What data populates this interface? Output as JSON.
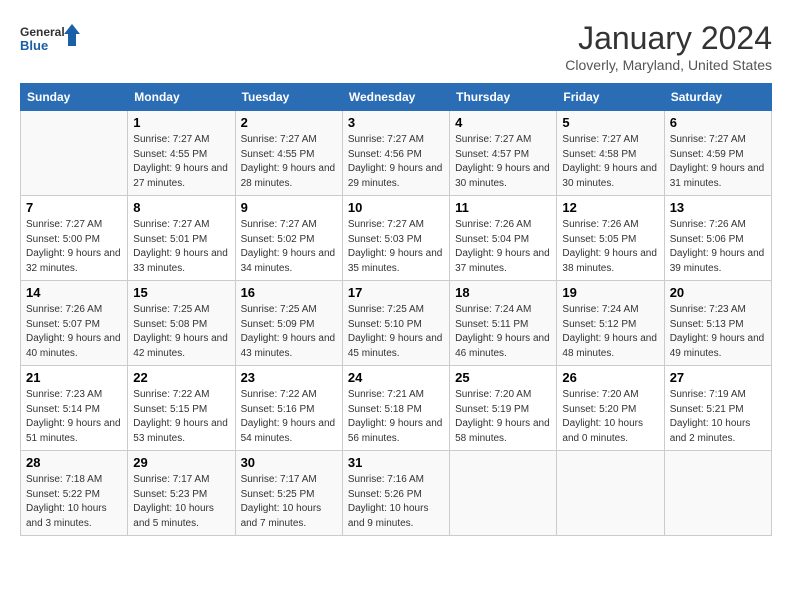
{
  "header": {
    "logo_general": "General",
    "logo_blue": "Blue",
    "month": "January 2024",
    "location": "Cloverly, Maryland, United States"
  },
  "days_of_week": [
    "Sunday",
    "Monday",
    "Tuesday",
    "Wednesday",
    "Thursday",
    "Friday",
    "Saturday"
  ],
  "weeks": [
    [
      {
        "num": "",
        "text": ""
      },
      {
        "num": "1",
        "text": "Sunrise: 7:27 AM\nSunset: 4:55 PM\nDaylight: 9 hours\nand 27 minutes."
      },
      {
        "num": "2",
        "text": "Sunrise: 7:27 AM\nSunset: 4:55 PM\nDaylight: 9 hours\nand 28 minutes."
      },
      {
        "num": "3",
        "text": "Sunrise: 7:27 AM\nSunset: 4:56 PM\nDaylight: 9 hours\nand 29 minutes."
      },
      {
        "num": "4",
        "text": "Sunrise: 7:27 AM\nSunset: 4:57 PM\nDaylight: 9 hours\nand 30 minutes."
      },
      {
        "num": "5",
        "text": "Sunrise: 7:27 AM\nSunset: 4:58 PM\nDaylight: 9 hours\nand 30 minutes."
      },
      {
        "num": "6",
        "text": "Sunrise: 7:27 AM\nSunset: 4:59 PM\nDaylight: 9 hours\nand 31 minutes."
      }
    ],
    [
      {
        "num": "7",
        "text": "Sunrise: 7:27 AM\nSunset: 5:00 PM\nDaylight: 9 hours\nand 32 minutes."
      },
      {
        "num": "8",
        "text": "Sunrise: 7:27 AM\nSunset: 5:01 PM\nDaylight: 9 hours\nand 33 minutes."
      },
      {
        "num": "9",
        "text": "Sunrise: 7:27 AM\nSunset: 5:02 PM\nDaylight: 9 hours\nand 34 minutes."
      },
      {
        "num": "10",
        "text": "Sunrise: 7:27 AM\nSunset: 5:03 PM\nDaylight: 9 hours\nand 35 minutes."
      },
      {
        "num": "11",
        "text": "Sunrise: 7:26 AM\nSunset: 5:04 PM\nDaylight: 9 hours\nand 37 minutes."
      },
      {
        "num": "12",
        "text": "Sunrise: 7:26 AM\nSunset: 5:05 PM\nDaylight: 9 hours\nand 38 minutes."
      },
      {
        "num": "13",
        "text": "Sunrise: 7:26 AM\nSunset: 5:06 PM\nDaylight: 9 hours\nand 39 minutes."
      }
    ],
    [
      {
        "num": "14",
        "text": "Sunrise: 7:26 AM\nSunset: 5:07 PM\nDaylight: 9 hours\nand 40 minutes."
      },
      {
        "num": "15",
        "text": "Sunrise: 7:25 AM\nSunset: 5:08 PM\nDaylight: 9 hours\nand 42 minutes."
      },
      {
        "num": "16",
        "text": "Sunrise: 7:25 AM\nSunset: 5:09 PM\nDaylight: 9 hours\nand 43 minutes."
      },
      {
        "num": "17",
        "text": "Sunrise: 7:25 AM\nSunset: 5:10 PM\nDaylight: 9 hours\nand 45 minutes."
      },
      {
        "num": "18",
        "text": "Sunrise: 7:24 AM\nSunset: 5:11 PM\nDaylight: 9 hours\nand 46 minutes."
      },
      {
        "num": "19",
        "text": "Sunrise: 7:24 AM\nSunset: 5:12 PM\nDaylight: 9 hours\nand 48 minutes."
      },
      {
        "num": "20",
        "text": "Sunrise: 7:23 AM\nSunset: 5:13 PM\nDaylight: 9 hours\nand 49 minutes."
      }
    ],
    [
      {
        "num": "21",
        "text": "Sunrise: 7:23 AM\nSunset: 5:14 PM\nDaylight: 9 hours\nand 51 minutes."
      },
      {
        "num": "22",
        "text": "Sunrise: 7:22 AM\nSunset: 5:15 PM\nDaylight: 9 hours\nand 53 minutes."
      },
      {
        "num": "23",
        "text": "Sunrise: 7:22 AM\nSunset: 5:16 PM\nDaylight: 9 hours\nand 54 minutes."
      },
      {
        "num": "24",
        "text": "Sunrise: 7:21 AM\nSunset: 5:18 PM\nDaylight: 9 hours\nand 56 minutes."
      },
      {
        "num": "25",
        "text": "Sunrise: 7:20 AM\nSunset: 5:19 PM\nDaylight: 9 hours\nand 58 minutes."
      },
      {
        "num": "26",
        "text": "Sunrise: 7:20 AM\nSunset: 5:20 PM\nDaylight: 10 hours\nand 0 minutes."
      },
      {
        "num": "27",
        "text": "Sunrise: 7:19 AM\nSunset: 5:21 PM\nDaylight: 10 hours\nand 2 minutes."
      }
    ],
    [
      {
        "num": "28",
        "text": "Sunrise: 7:18 AM\nSunset: 5:22 PM\nDaylight: 10 hours\nand 3 minutes."
      },
      {
        "num": "29",
        "text": "Sunrise: 7:17 AM\nSunset: 5:23 PM\nDaylight: 10 hours\nand 5 minutes."
      },
      {
        "num": "30",
        "text": "Sunrise: 7:17 AM\nSunset: 5:25 PM\nDaylight: 10 hours\nand 7 minutes."
      },
      {
        "num": "31",
        "text": "Sunrise: 7:16 AM\nSunset: 5:26 PM\nDaylight: 10 hours\nand 9 minutes."
      },
      {
        "num": "",
        "text": ""
      },
      {
        "num": "",
        "text": ""
      },
      {
        "num": "",
        "text": ""
      }
    ]
  ]
}
